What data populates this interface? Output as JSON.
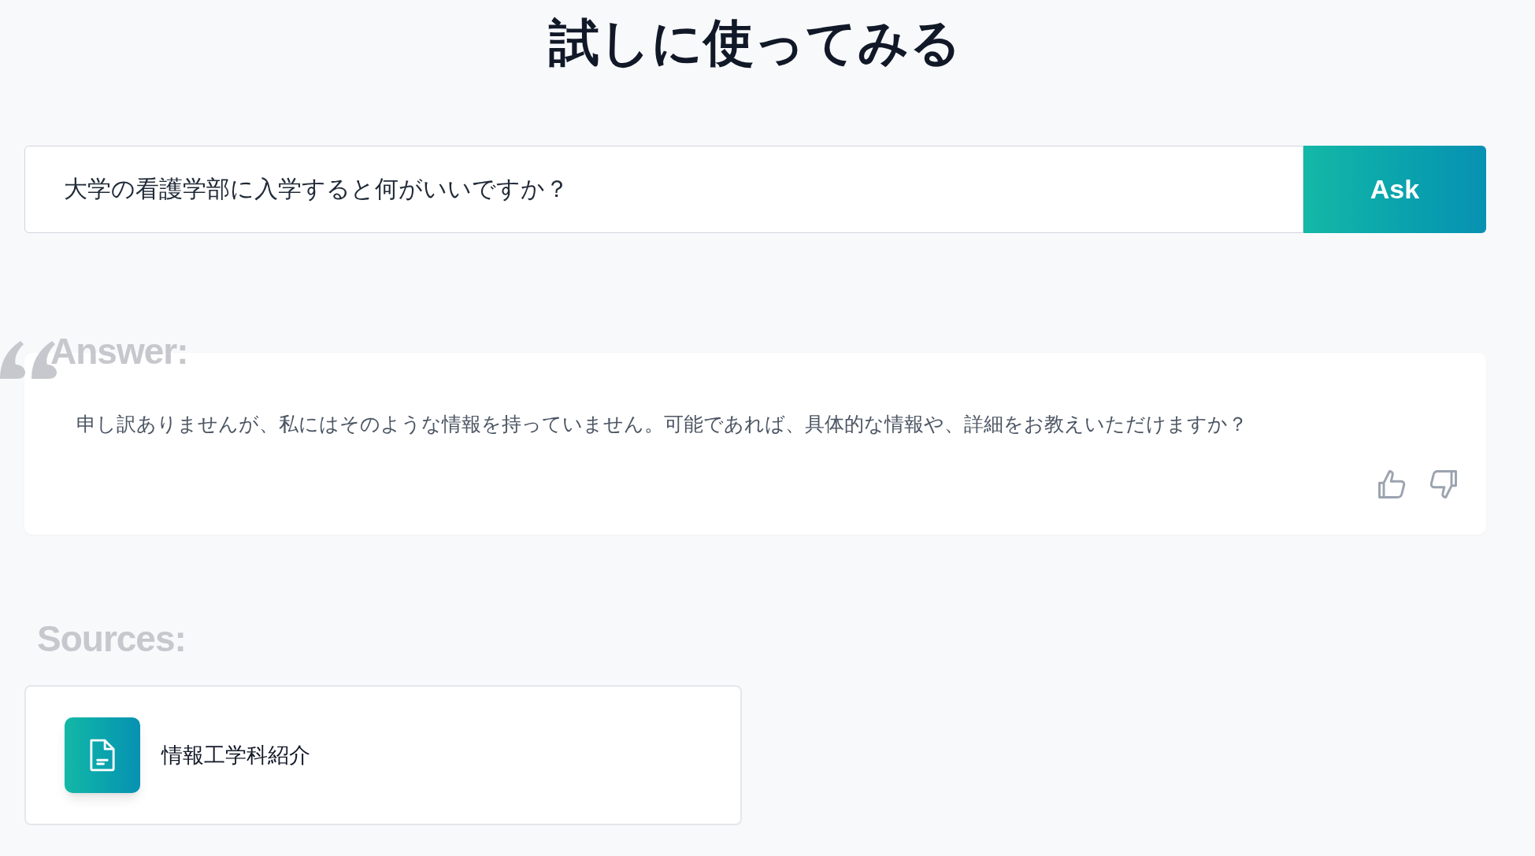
{
  "title": "試しに使ってみる",
  "search": {
    "value": "大学の看護学部に入学すると何がいいですか？",
    "button": "Ask"
  },
  "answer": {
    "heading": "Answer:",
    "text": "申し訳ありませんが、私にはそのような情報を持っていません。可能であれば、具体的な情報や、詳細をお教えいただけますか？"
  },
  "sources": {
    "heading": "Sources:",
    "items": [
      {
        "title": "情報工学科紹介"
      }
    ]
  }
}
